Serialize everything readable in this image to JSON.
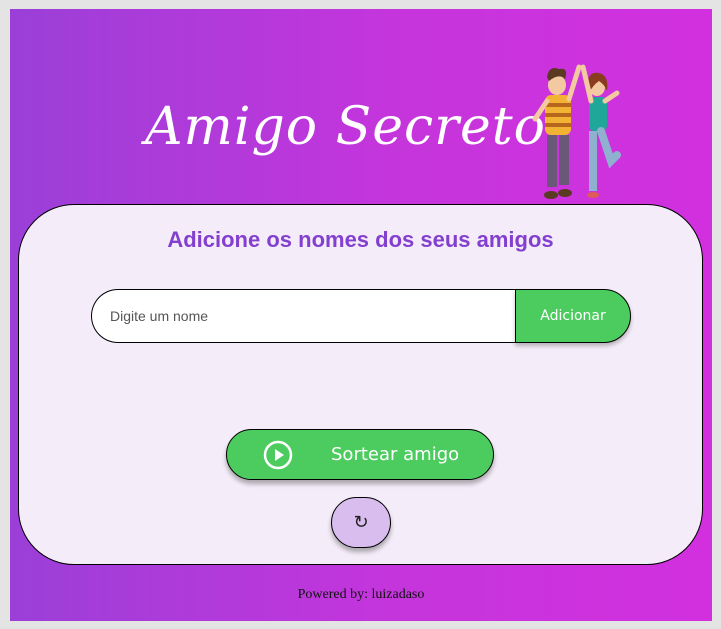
{
  "header": {
    "title": "Amigo Secreto",
    "illustration_icon": "friends-high-five-illustration"
  },
  "card": {
    "heading": "Adicione os nomes dos seus amigos",
    "input": {
      "placeholder": "Digite um nome",
      "value": ""
    },
    "add_button_label": "Adicionar",
    "draw_button_label": "Sortear amigo",
    "draw_button_icon": "play-circle-icon",
    "reset_button_label": "↻",
    "reset_button_icon": "refresh-icon"
  },
  "footer": {
    "text": "Powered by: luizadaso"
  },
  "colors": {
    "background_start": "#9b3fd8",
    "background_end": "#d230de",
    "card_bg": "#f4ecf8",
    "heading": "#8340cf",
    "button_green": "#4ccc5e",
    "reset_bg": "#d8bdee"
  }
}
